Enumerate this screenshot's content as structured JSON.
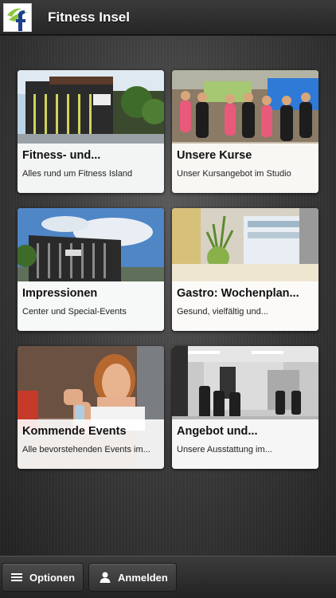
{
  "header": {
    "title": "Fitness Insel",
    "logo_icon": "fitness-insel-logo"
  },
  "tiles": [
    {
      "title": "Fitness- und...",
      "subtitle": "Alles rund um Fitness Island"
    },
    {
      "title": "Unsere Kurse",
      "subtitle": "Unser Kursangebot im Studio"
    },
    {
      "title": "Impressionen",
      "subtitle": "Center und Special-Events"
    },
    {
      "title": "Gastro: Wochenplan...",
      "subtitle": "Gesund, vielfältig und..."
    },
    {
      "title": "Kommende Events",
      "subtitle": "Alle bevorstehenden Events im..."
    },
    {
      "title": "Angebot und...",
      "subtitle": "Unsere Ausstattung im..."
    }
  ],
  "footer": {
    "options_label": "Optionen",
    "options_icon": "menu-icon",
    "login_label": "Anmelden",
    "login_icon": "user-icon"
  },
  "colors": {
    "header_bg": "#2e2e2e",
    "logo_green": "#8dc63f",
    "logo_blue": "#1e3f8a"
  }
}
